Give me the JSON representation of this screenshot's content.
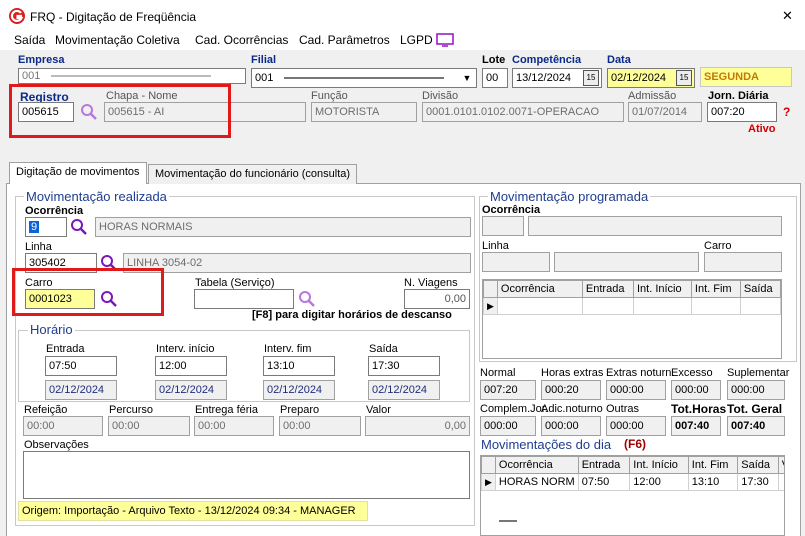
{
  "window": {
    "title": "FRQ - Digitação de Freqüência",
    "close_glyph": "✕"
  },
  "menu": [
    "Saída",
    "Movimentação Coletiva",
    "Cad. Ocorrências",
    "Cad. Parâmetros",
    "LGPD"
  ],
  "header": {
    "empresa_label": "Empresa",
    "empresa_value": "001",
    "filial_label": "Filial",
    "filial_value": "001",
    "lote_label": "Lote",
    "lote_value": "00",
    "competencia_label": "Competência",
    "competencia_value": "13/12/2024",
    "data_label": "Data",
    "data_value": "02/12/2024",
    "weekday": "SEGUNDA",
    "registro_label": "Registro",
    "registro_value": "005615",
    "chapa_label": "Chapa - Nome",
    "chapa_value": "005615 - AI",
    "funcao_label": "Função",
    "funcao_value": "MOTORISTA",
    "divisao_label": "Divisão",
    "divisao_value": "0001.0101.0102.0071-OPERACAO",
    "admissao_label": "Admissão",
    "admissao_value": "01/07/2014",
    "jornada_label": "Jorn. Diária",
    "jornada_value": "007:20",
    "help_glyph": "?",
    "status": "Ativo"
  },
  "tabs": [
    "Digitação de movimentos",
    "Movimentação do funcionário (consulta)"
  ],
  "realizada": {
    "title": "Movimentação realizada",
    "ocorrencia_label": "Ocorrência",
    "ocorrencia_code": "9",
    "ocorrencia_desc": "HORAS NORMAIS",
    "linha_label": "Linha",
    "linha_code": "305402",
    "linha_desc": "LINHA 3054-02",
    "carro_label": "Carro",
    "carro_value": "0001023",
    "tabela_label": "Tabela (Serviço)",
    "tabela_value": "",
    "viagens_label": "N. Viagens",
    "viagens_value": "0,00",
    "f8_hint": "[F8] para digitar horários de descanso"
  },
  "horario": {
    "title": "Horário",
    "columns": [
      {
        "label": "Entrada",
        "time": "07:50",
        "date": "02/12/2024"
      },
      {
        "label": "Interv. início",
        "time": "12:00",
        "date": "02/12/2024"
      },
      {
        "label": "Interv. fim",
        "time": "13:10",
        "date": "02/12/2024"
      },
      {
        "label": "Saída",
        "time": "17:30",
        "date": "02/12/2024"
      }
    ]
  },
  "extras": {
    "refeicao_label": "Refeição",
    "refeicao_value": "00:00",
    "percurso_label": "Percurso",
    "percurso_value": "00:00",
    "entrega_label": "Entrega féria",
    "entrega_value": "00:00",
    "preparo_label": "Preparo",
    "preparo_value": "00:00",
    "valor_label": "Valor",
    "valor_value": "0,00",
    "obs_label": "Observações"
  },
  "origem": "Origem: Importação - Arquivo Texto - 13/12/2024 09:34 - MANAGER",
  "programada": {
    "title": "Movimentação programada",
    "ocorrencia_label": "Ocorrência",
    "linha_label": "Linha",
    "carro_label": "Carro",
    "grid_headers": [
      "Ocorrência",
      "Entrada",
      "Int. Início",
      "Int. Fim",
      "Saída"
    ],
    "row_marker": "▶"
  },
  "totals": {
    "row1": [
      {
        "label": "Normal",
        "value": "007:20"
      },
      {
        "label": "Horas extras",
        "value": "000:20"
      },
      {
        "label": "Extras noturn.",
        "value": "000:00"
      },
      {
        "label": "Excesso",
        "value": "000:00"
      },
      {
        "label": "Suplementar",
        "value": "000:00"
      }
    ],
    "row2": [
      {
        "label": "Complem.Jor.",
        "value": "000:00"
      },
      {
        "label": "Adic.noturno",
        "value": "000:00"
      },
      {
        "label": "Outras",
        "value": "000:00"
      },
      {
        "label": "Tot.Horas",
        "value": "007:40"
      },
      {
        "label": "Tot. Geral",
        "value": "007:40"
      }
    ]
  },
  "dia": {
    "title": "Movimentações do dia",
    "hotkey": "(F6)",
    "headers": [
      "Ocorrência",
      "Entrada",
      "Int. Início",
      "Int. Fim",
      "Saída",
      "Va"
    ],
    "rows": [
      [
        "HORAS NORM",
        "07:50",
        "12:00",
        "13:10",
        "17:30",
        ""
      ]
    ],
    "row_marker": "▶"
  },
  "colors": {
    "accent_blue": "#1f3d8f",
    "highlight_red": "#e11919",
    "field_yellow": "#ffff99",
    "status_red": "#d00000"
  }
}
